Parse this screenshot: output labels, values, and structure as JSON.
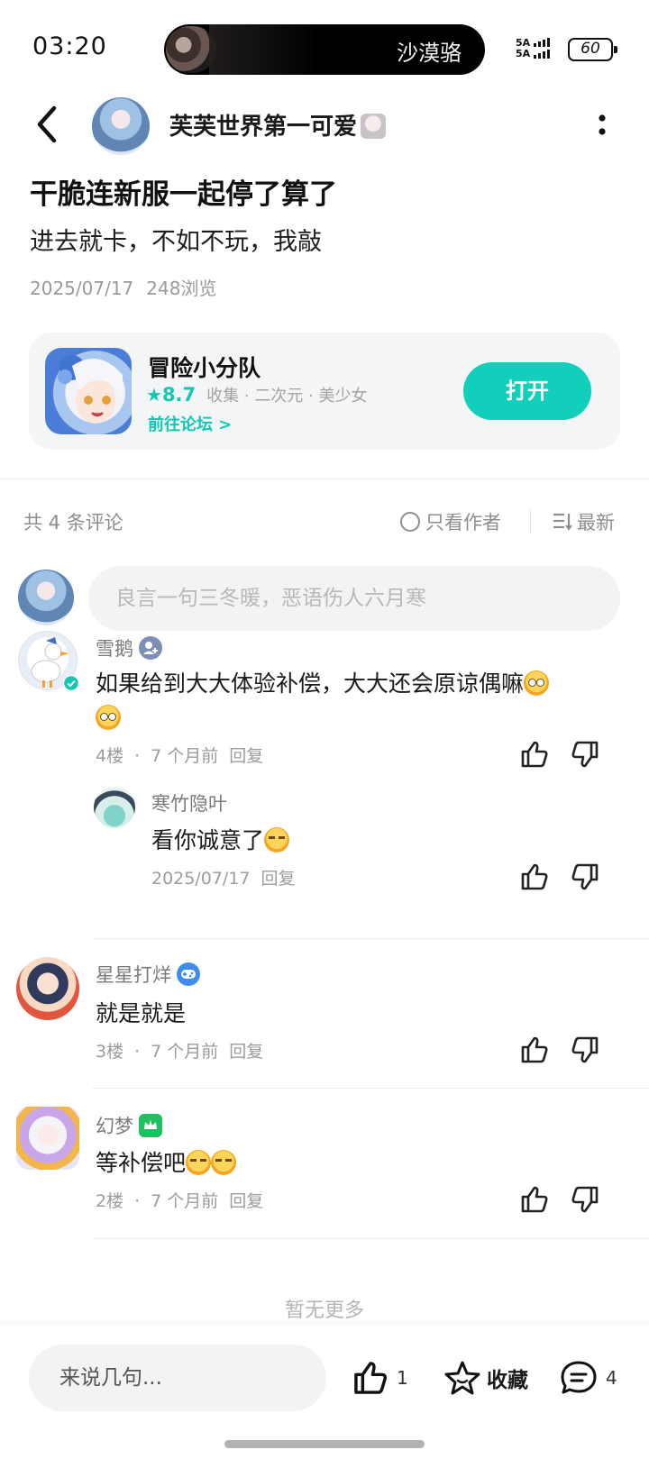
{
  "status_bar": {
    "time": "03:20",
    "now_playing": "沙漠骆",
    "network": "5A",
    "battery": "60"
  },
  "header": {
    "author_name": "芙芙世界第一可爱"
  },
  "post": {
    "title": "干脆连新服一起停了算了",
    "body": "进去就卡，不如不玩，我敲",
    "date": "2025/07/17",
    "views": "248浏览"
  },
  "app_card": {
    "name": "冒险小分队",
    "rating": "8.7",
    "tags": "收集 · 二次元 · 美少女",
    "forum_link": "前往论坛 >",
    "open_label": "打开"
  },
  "comments_header": {
    "count": "共 4 条评论",
    "author_only": "只看作者",
    "sort": "最新"
  },
  "comment_input": {
    "placeholder": "良言一句三冬暖，恶语伤人六月寒"
  },
  "comments": [
    {
      "name": "雪鹅",
      "text": "如果给到大大体验补偿，大大还会原谅偶嘛",
      "floor": "4楼",
      "time": "7 个月前",
      "reply_label": "回复",
      "reply": {
        "name": "寒竹隐叶",
        "text": "看你诚意了",
        "date": "2025/07/17",
        "reply_label": "回复"
      }
    },
    {
      "name": "星星打烊",
      "text": "就是就是",
      "floor": "3楼",
      "time": "7 个月前",
      "reply_label": "回复"
    },
    {
      "name": "幻梦",
      "text": "等补偿吧",
      "floor": "2楼",
      "time": "7 个月前",
      "reply_label": "回复"
    }
  ],
  "no_more": "暂无更多",
  "bottom_bar": {
    "input_placeholder": "来说几句...",
    "like_count": "1",
    "fav_label": "收藏",
    "comment_count": "4"
  },
  "colors": {
    "accent": "#12cfbb",
    "text": "#1a1a1a",
    "muted": "#9c9c9c"
  },
  "icons": [
    "back-arrow-icon",
    "more-vertical-icon",
    "star-icon",
    "radio-icon",
    "sort-icon",
    "thumbs-up-icon",
    "thumbs-down-icon",
    "star-outline-icon",
    "comment-icon",
    "verified-icon",
    "user-badge-icon",
    "gamepad-badge-icon",
    "crown-badge-icon"
  ]
}
